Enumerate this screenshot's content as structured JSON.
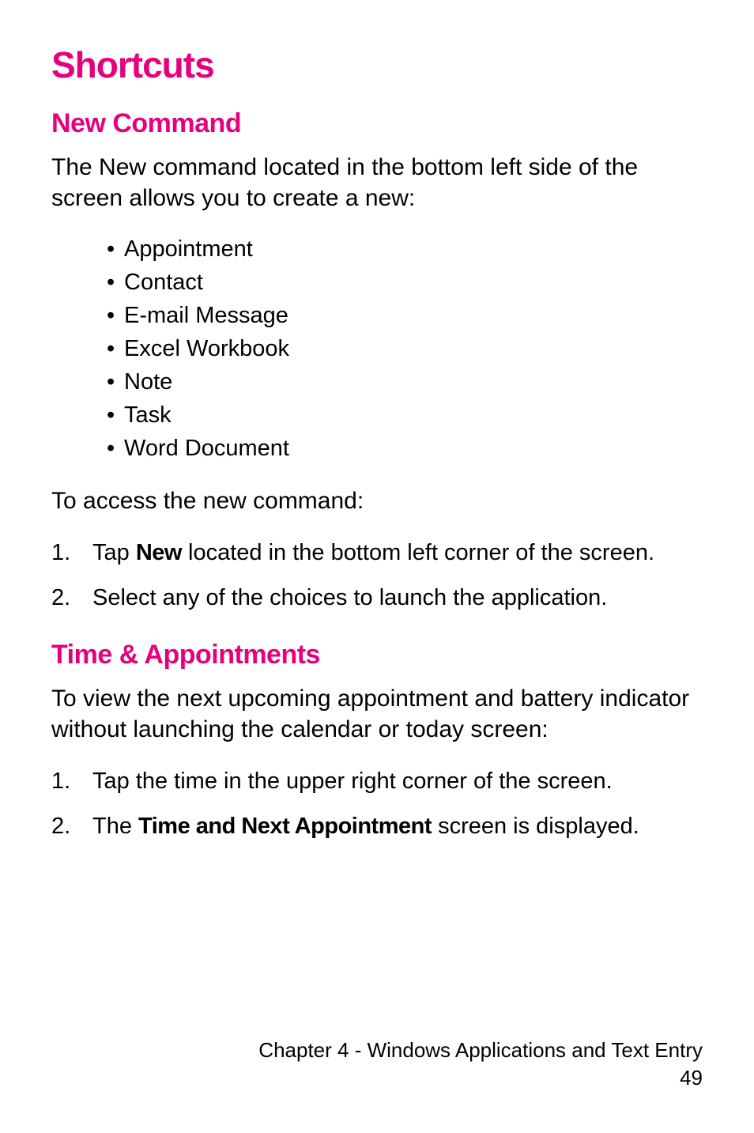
{
  "title": "Shortcuts",
  "section1": {
    "heading": "New Command",
    "intro": "The New command located in the bottom left side of the screen allows you to create a new:",
    "bullets": [
      "Appointment",
      "Contact",
      "E-mail Message",
      "Excel Workbook",
      "Note",
      "Task",
      "Word Document"
    ],
    "access_text": "To access the new command:",
    "steps": [
      {
        "pre": "Tap ",
        "bold": "New",
        "post": " located in the bottom left corner of the screen."
      },
      {
        "pre": "Select any of the choices to launch the application.",
        "bold": "",
        "post": ""
      }
    ]
  },
  "section2": {
    "heading": "Time & Appointments",
    "intro": "To view the next upcoming appointment and battery indicator without launching the calendar or today screen:",
    "steps": [
      {
        "pre": "Tap the time in the upper right corner of the screen.",
        "bold": "",
        "post": ""
      },
      {
        "pre": "The ",
        "bold": "Time and Next Appointment",
        "post": " screen is displayed."
      }
    ]
  },
  "footer": {
    "chapter": "Chapter 4 - Windows Applications and Text Entry",
    "page": "49"
  }
}
